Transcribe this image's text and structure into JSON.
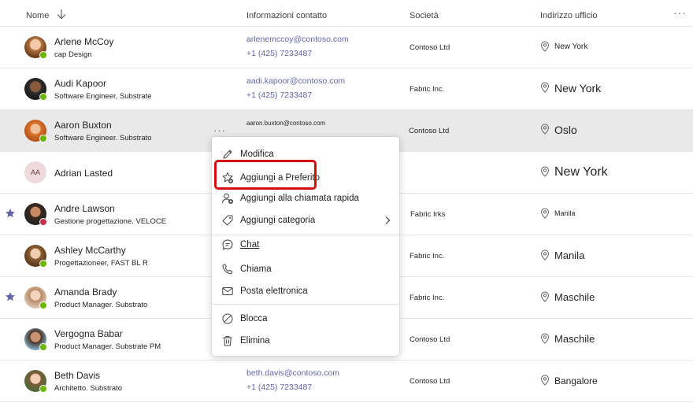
{
  "header": {
    "name": "Nome",
    "contact": "Informazioni contatto",
    "company": "Società",
    "office": "Indirizzo ufficio",
    "more": "···"
  },
  "rows": [
    {
      "name": "Arlene McCoy",
      "title": "cap Design",
      "email": "arlenemccoy@contoso.com",
      "phone": "+1 (425) 7233487",
      "company": "Contoso Ltd",
      "office": "New York",
      "presence": "available"
    },
    {
      "name": "Audi Kapoor",
      "title": "Software Engineer, Substrate",
      "email": "aadi.kapoor@contoso.com",
      "phone": "+1 (425) 7233487",
      "company": "Fabric Inc.",
      "office": "New York",
      "presence": "available"
    },
    {
      "name": "Aaron Buxton",
      "title": "Software Engineer. Substrato",
      "email": "aaron.buxton@contoso.com",
      "company": "Contoso Ltd",
      "office": "Oslo",
      "presence": "available",
      "more": "···"
    },
    {
      "name": "Adrian Lasted",
      "initials": "AA",
      "office": "New York"
    },
    {
      "name": "Andre Lawson",
      "title": "Gestione progettazione. VELOCE",
      "company": "Fabric Irks",
      "office": "Manila",
      "presence": "busy",
      "favorite": true
    },
    {
      "name": "Ashley McCarthy",
      "title": "Progettazioneer, FAST BL R",
      "company": "Fabric Inc.",
      "office": "Manila",
      "presence": "available"
    },
    {
      "name": "Amanda Brady",
      "title": "Product Manager. Substrato",
      "company": "Fabric Inc.",
      "office": "Maschile",
      "presence": "available",
      "favorite": true
    },
    {
      "name": "Vergogna Babar",
      "title": "Product Manager. Substrate PM",
      "company": "Contoso Ltd",
      "office": "Maschile",
      "presence": "available"
    },
    {
      "name": "Beth Davis",
      "title": "Architetto. Substrato",
      "email": "beth.davis@contoso.com",
      "phone": "+1 (425) 7233487",
      "company": "Contoso Ltd",
      "office": "Bangalore",
      "presence": "available"
    }
  ],
  "menu": {
    "edit": "Modifica",
    "add_favorite": "Aggiungi a Preferito",
    "add_speed_dial": "Aggiungi alla chiamata rapida",
    "add_category": "Aggiungi categoria",
    "chat": "Chat",
    "call": "Chiama",
    "email": "Posta elettronica",
    "block": "Blocca",
    "delete": "Elimina"
  },
  "colors": {
    "accent": "#6264a7",
    "available": "#6bb700",
    "busy": "#c4314b",
    "selected_row": "#e9e9e9",
    "highlight": "#d40f0f"
  }
}
